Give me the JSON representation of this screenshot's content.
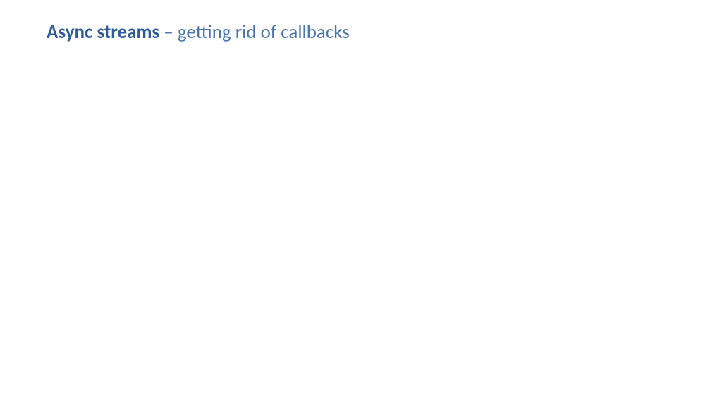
{
  "slide": {
    "title_bold": "Async streams",
    "title_rest": " – getting rid of callbacks"
  }
}
